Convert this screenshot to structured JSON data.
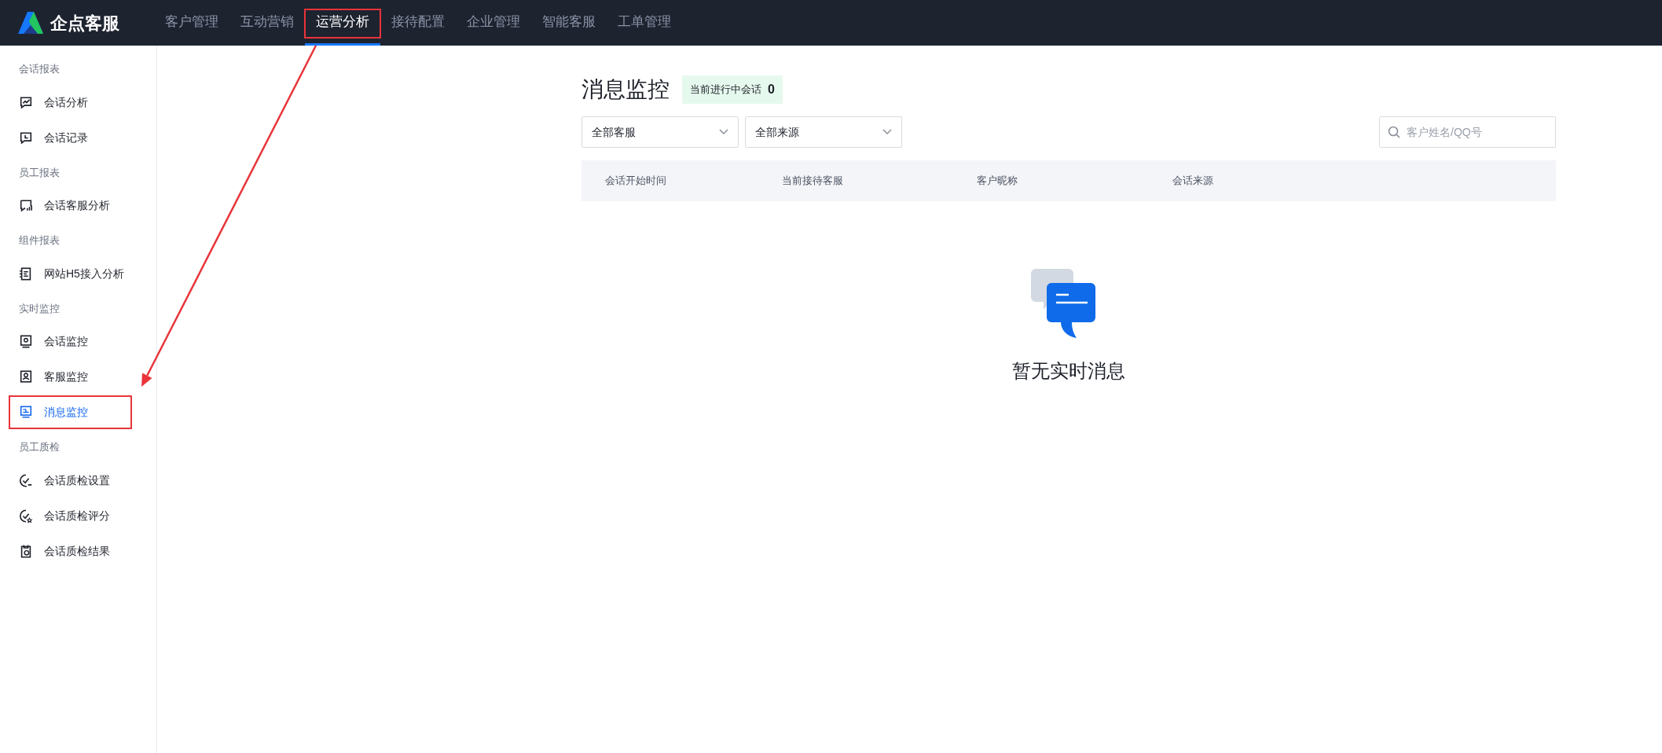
{
  "brand": {
    "name": "企点客服"
  },
  "top_nav": [
    {
      "label": "客户管理",
      "selected": false
    },
    {
      "label": "互动营销",
      "selected": false
    },
    {
      "label": "运营分析",
      "selected": true
    },
    {
      "label": "接待配置",
      "selected": false
    },
    {
      "label": "企业管理",
      "selected": false
    },
    {
      "label": "智能客服",
      "selected": false
    },
    {
      "label": "工单管理",
      "selected": false
    }
  ],
  "sidebar": {
    "groups": [
      {
        "title": "会话报表",
        "items": [
          {
            "label": "会话分析",
            "selected": false
          },
          {
            "label": "会话记录",
            "selected": false
          }
        ]
      },
      {
        "title": "员工报表",
        "items": [
          {
            "label": "会话客服分析",
            "selected": false
          }
        ]
      },
      {
        "title": "组件报表",
        "items": [
          {
            "label": "网站H5接入分析",
            "selected": false
          }
        ]
      },
      {
        "title": "实时监控",
        "items": [
          {
            "label": "会话监控",
            "selected": false
          },
          {
            "label": "客服监控",
            "selected": false
          },
          {
            "label": "消息监控",
            "selected": true
          }
        ]
      },
      {
        "title": "员工质检",
        "items": [
          {
            "label": "会话质检设置",
            "selected": false
          },
          {
            "label": "会话质检评分",
            "selected": false
          },
          {
            "label": "会话质检结果",
            "selected": false
          }
        ]
      }
    ]
  },
  "page": {
    "title": "消息监控",
    "badge": {
      "label": "当前进行中会话",
      "count": "0"
    },
    "filters": [
      {
        "value": "全部客服"
      },
      {
        "value": "全部来源"
      }
    ],
    "search": {
      "placeholder": "客户姓名/QQ号"
    },
    "table": {
      "columns": [
        "会话开始时间",
        "当前接待客服",
        "客户昵称",
        "会话来源"
      ]
    },
    "empty_state": {
      "message": "暂无实时消息"
    }
  },
  "annotations": {
    "highlight_selected_tab": true,
    "highlight_selected_sidebar_item": true,
    "arrow": true
  }
}
